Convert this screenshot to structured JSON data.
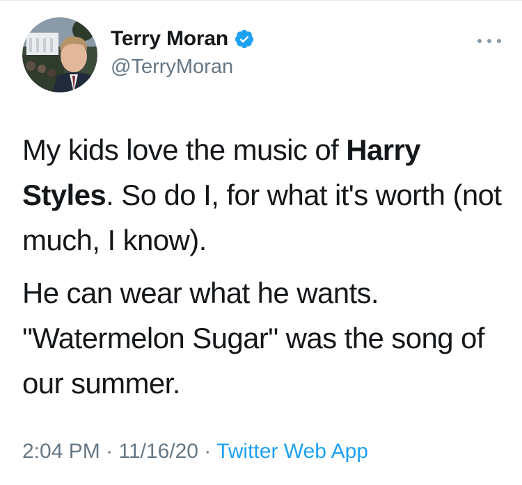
{
  "user": {
    "display_name": "Terry Moran",
    "handle": "@TerryMoran",
    "verified": true,
    "verified_color": "#1da1f2"
  },
  "tweet": {
    "p1_a": "My kids love the music of ",
    "p1_bold": "Harry Styles",
    "p1_b": ". So do I, for what it's worth (not much, I know).",
    "p2": "He can wear what he wants. \"Watermelon Sugar\" was the song of our summer."
  },
  "meta": {
    "time": "2:04 PM",
    "sep1": " · ",
    "date": "11/16/20",
    "sep2": " · ",
    "source": "Twitter Web App"
  },
  "icons": {
    "more": "more-horizontal-icon",
    "verified": "verified-badge-icon"
  }
}
